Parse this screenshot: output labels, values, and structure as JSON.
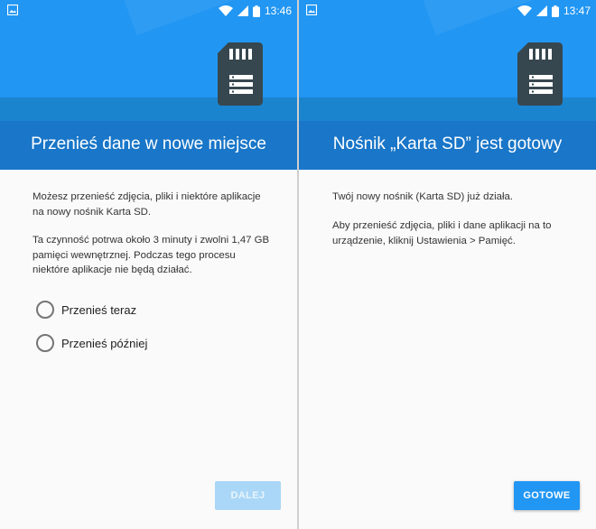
{
  "colors": {
    "accent": "#2196f3",
    "header_band": "#1976c8",
    "button_disabled": "#aad7f7"
  },
  "left": {
    "status_bar": {
      "time": "13:46",
      "icons": [
        "image-icon",
        "wifi-icon",
        "signal-icon",
        "battery-icon"
      ]
    },
    "hero_icon": "sd-card-icon",
    "title": "Przenieś dane w nowe miejsce",
    "paragraph_1": "Możesz przenieść zdjęcia, pliki i niektóre aplikacje na nowy nośnik Karta SD.",
    "paragraph_2": "Ta czynność potrwa około 3 minuty i zwolni 1,47 GB pamięci wewnętrznej. Podczas tego procesu niektóre aplikacje nie będą działać.",
    "options": [
      {
        "label": "Przenieś teraz",
        "selected": false
      },
      {
        "label": "Przenieś później",
        "selected": false
      }
    ],
    "next_button": {
      "label": "DALEJ",
      "enabled": false
    }
  },
  "right": {
    "status_bar": {
      "time": "13:47",
      "icons": [
        "image-icon",
        "wifi-icon",
        "signal-icon",
        "battery-icon"
      ]
    },
    "hero_icon": "sd-card-icon",
    "title": "Nośnik „Karta SD” jest gotowy",
    "paragraph_1": "Twój nowy nośnik (Karta SD) już działa.",
    "paragraph_2": "Aby przenieść zdjęcia, pliki i dane aplikacji na to urządzenie, kliknij Ustawienia > Pamięć.",
    "done_button": {
      "label": "GOTOWE",
      "enabled": true
    }
  }
}
